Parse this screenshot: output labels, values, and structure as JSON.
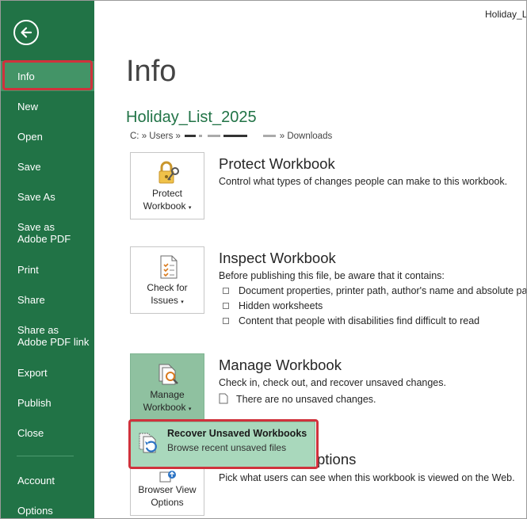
{
  "window": {
    "file_name": "Holiday_L"
  },
  "sidebar": {
    "items": [
      {
        "label": "Info"
      },
      {
        "label": "New"
      },
      {
        "label": "Open"
      },
      {
        "label": "Save"
      },
      {
        "label": "Save As"
      },
      {
        "label": "Save as Adobe PDF"
      },
      {
        "label": "Print"
      },
      {
        "label": "Share"
      },
      {
        "label": "Share as Adobe PDF link"
      },
      {
        "label": "Export"
      },
      {
        "label": "Publish"
      },
      {
        "label": "Close"
      },
      {
        "label": "Account"
      },
      {
        "label": "Options"
      }
    ]
  },
  "main": {
    "page_title": "Info",
    "doc_title": "Holiday_List_2025",
    "path": {
      "prefix": "C: » Users »",
      "suffix": "» Downloads"
    },
    "protect": {
      "button_line1": "Protect",
      "button_line2": "Workbook",
      "title": "Protect Workbook",
      "desc": "Control what types of changes people can make to this workbook."
    },
    "inspect": {
      "button_line1": "Check for",
      "button_line2": "Issues",
      "title": "Inspect Workbook",
      "desc": "Before publishing this file, be aware that it contains:",
      "bullets": [
        "Document properties, printer path, author's name and absolute path",
        "Hidden worksheets",
        "Content that people with disabilities find difficult to read"
      ]
    },
    "manage": {
      "button_line1": "Manage",
      "button_line2": "Workbook",
      "title": "Manage Workbook",
      "desc": "Check in, check out, and recover unsaved changes.",
      "status": "There are no unsaved changes."
    },
    "dropdown": {
      "title": "Recover Unsaved Workbooks",
      "subtitle": "Browse recent unsaved files"
    },
    "browser": {
      "button_line1": "Browser View",
      "button_line2": "Options",
      "title_partial": "ptions",
      "desc": "Pick what users can see when this workbook is viewed on the Web."
    }
  },
  "colors": {
    "sidebar": "#217346",
    "selected": "#439467",
    "highlight": "#d0323c",
    "accent_text": "#217346"
  }
}
